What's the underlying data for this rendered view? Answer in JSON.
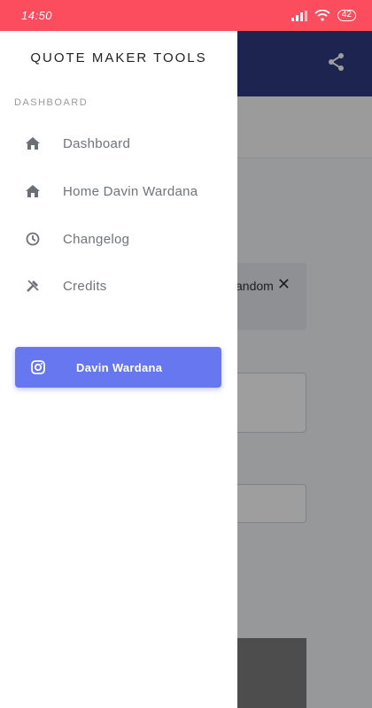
{
  "status": {
    "time": "14:50",
    "battery": "42"
  },
  "drawer": {
    "brand": "QUOTE MAKER TOOLS",
    "section": "DASHBOARD",
    "items": [
      {
        "label": "Dashboard",
        "icon": "home-icon"
      },
      {
        "label": "Home Davin Wardana",
        "icon": "home-icon"
      },
      {
        "label": "Changelog",
        "icon": "clock-icon"
      },
      {
        "label": "Credits",
        "icon": "tools-icon"
      }
    ],
    "cta": {
      "label": "Davin Wardana",
      "icon": "instagram-icon"
    }
  },
  "background": {
    "card_text": "andom"
  },
  "colors": {
    "status_bar": "#fb4d5d",
    "app_bar": "#2f3a82",
    "accent": "#6777ef"
  }
}
